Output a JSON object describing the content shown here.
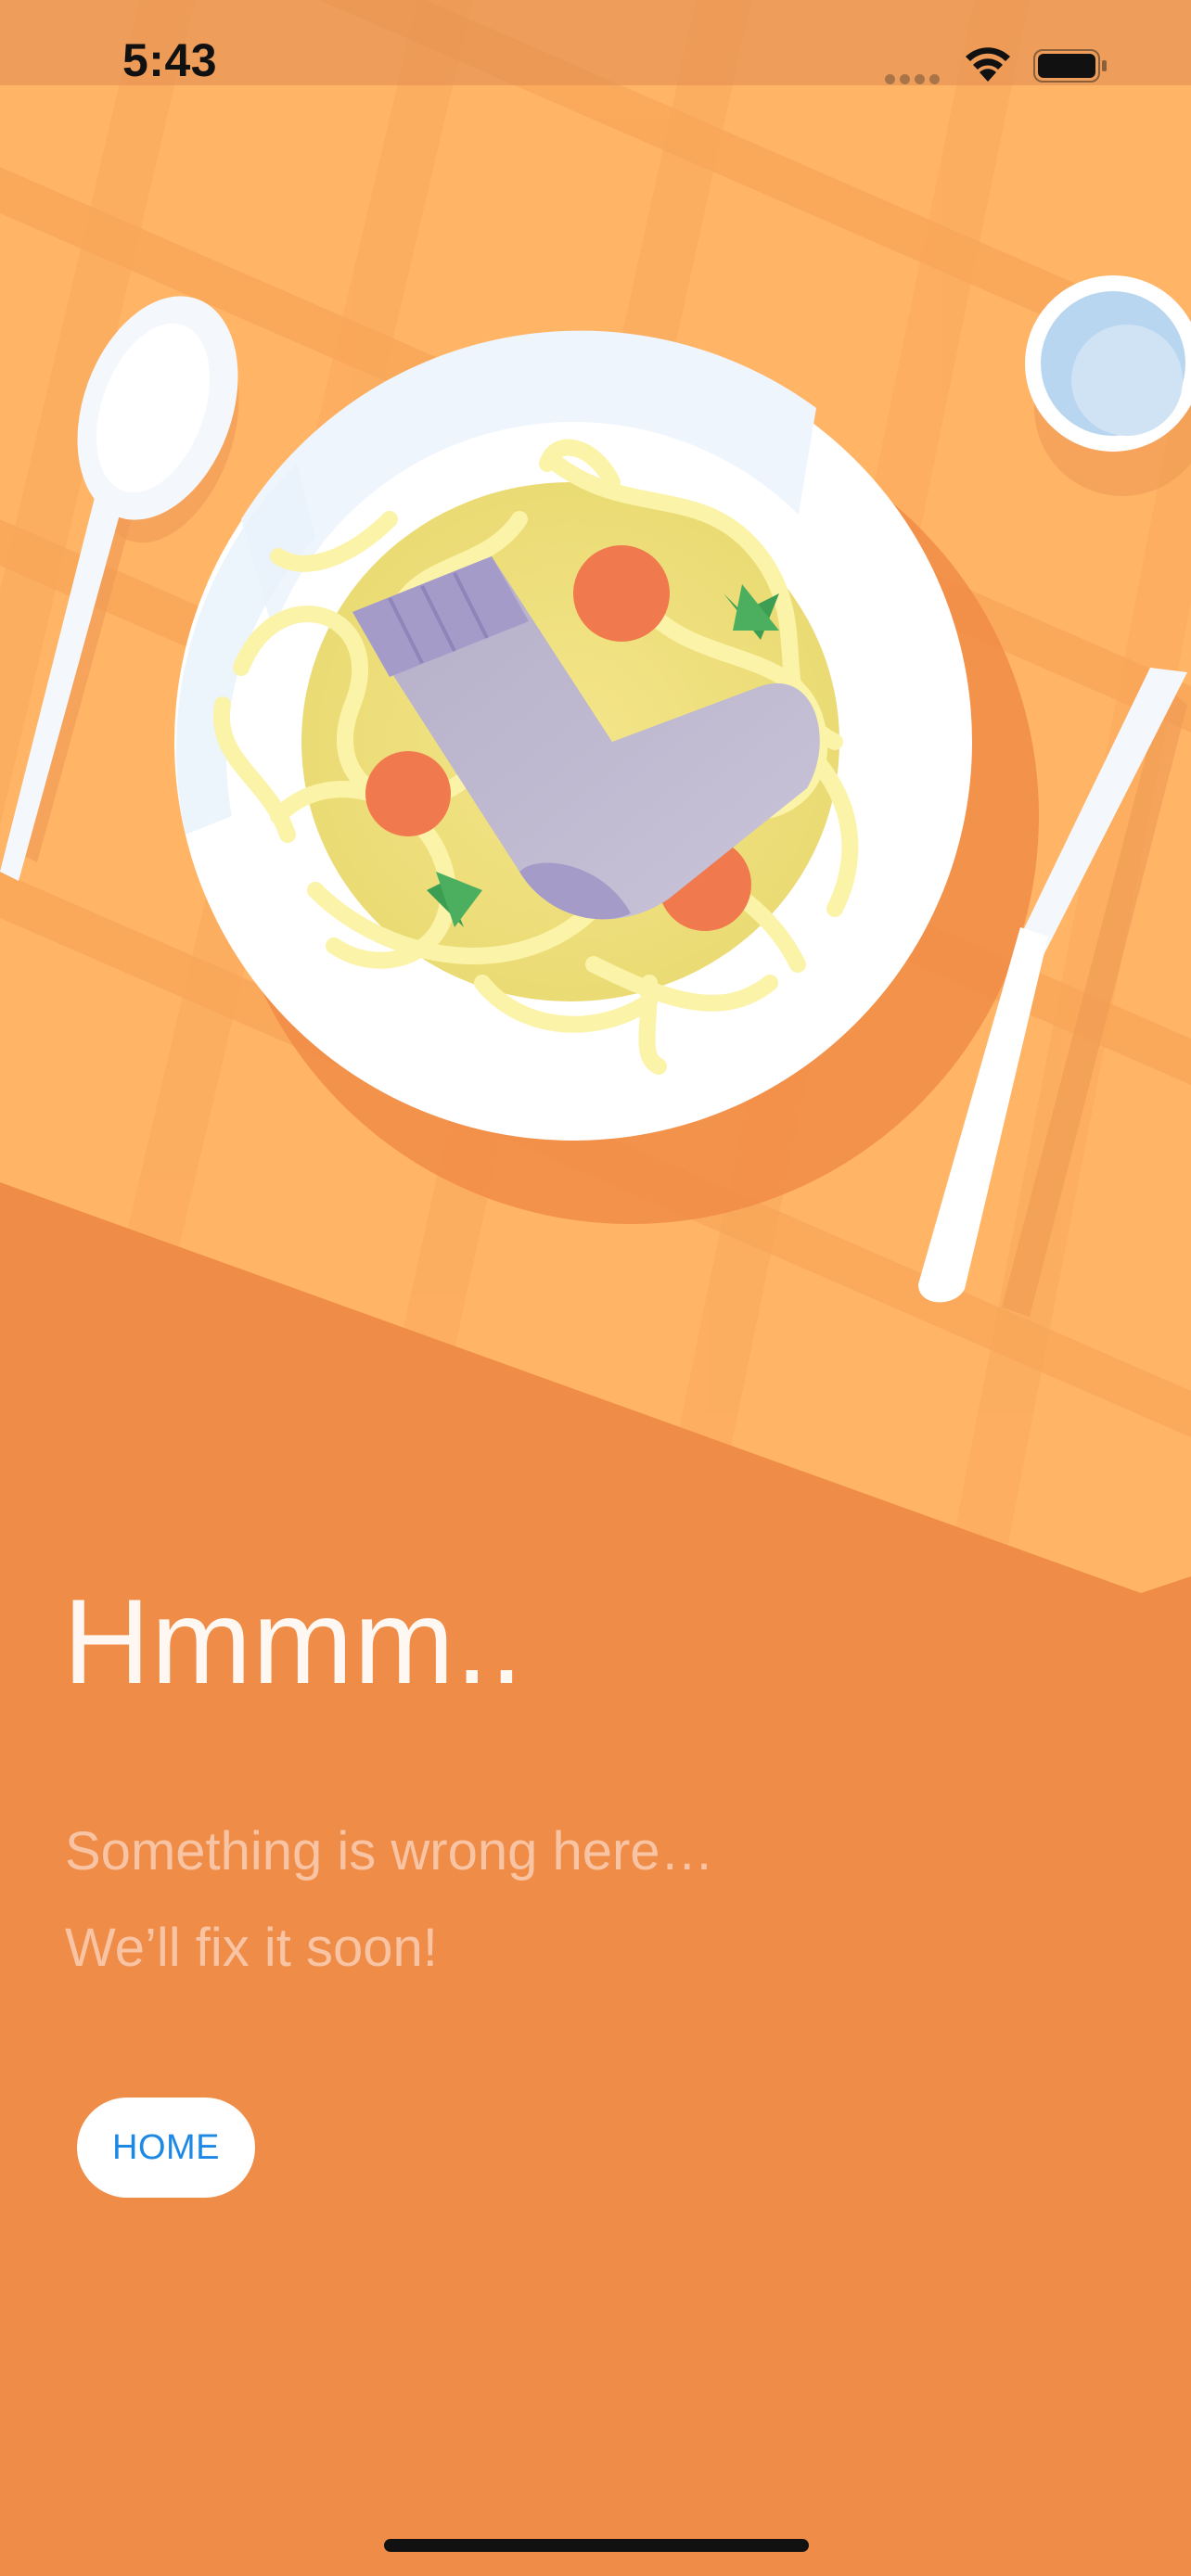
{
  "status_bar": {
    "time": "5:43",
    "icons": [
      "cellular-signal-icon",
      "wifi-icon",
      "battery-icon"
    ]
  },
  "error": {
    "title": "Hmmm..",
    "message_line_1": "Something is wrong here…",
    "message_line_2": "We’ll fix it soon!"
  },
  "home_button": {
    "label": "HOME"
  },
  "colors": {
    "background": "#EF8D48",
    "tablecloth": "#FFB466",
    "plate": "#FFFFFF",
    "button_text": "#1E88E5"
  }
}
